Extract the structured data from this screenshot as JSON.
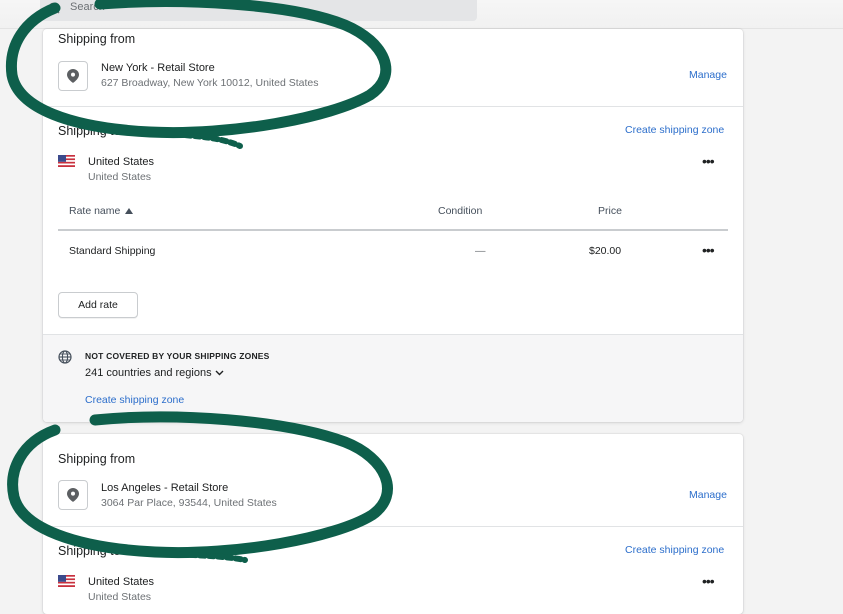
{
  "search": {
    "placeholder": "Search"
  },
  "zones": [
    {
      "from_title": "Shipping from",
      "location_name": "New York - Retail Store",
      "location_address": "627 Broadway, New York 10012, United States",
      "manage_label": "Manage",
      "to_title": "Shipping to",
      "create_zone_label": "Create shipping zone",
      "country": "United States",
      "country_sub": "United States",
      "table": {
        "headers": [
          "Rate name",
          "Condition",
          "Price"
        ],
        "rows": [
          {
            "name": "Standard Shipping",
            "condition": "—",
            "price": "$20.00"
          }
        ]
      },
      "add_rate_label": "Add rate",
      "not_covered": {
        "title": "NOT COVERED BY YOUR SHIPPING ZONES",
        "count": "241 countries and regions",
        "create_label": "Create shipping zone"
      }
    },
    {
      "from_title": "Shipping from",
      "location_name": "Los Angeles - Retail Store",
      "location_address": "3064 Par Place, 93544, United States",
      "manage_label": "Manage",
      "to_title": "Shipping to",
      "create_zone_label": "Create shipping zone",
      "country": "United States",
      "country_sub": "United States"
    }
  ],
  "colors": {
    "link": "#2c6ecb",
    "annotation": "#0e5f4b",
    "text": "#202223",
    "muted": "#6d7175"
  },
  "icons": [
    "search-icon",
    "location-pin-icon",
    "us-flag-icon",
    "more-actions-icon",
    "sort-ascending-icon",
    "globe-icon",
    "chevron-down-icon"
  ]
}
